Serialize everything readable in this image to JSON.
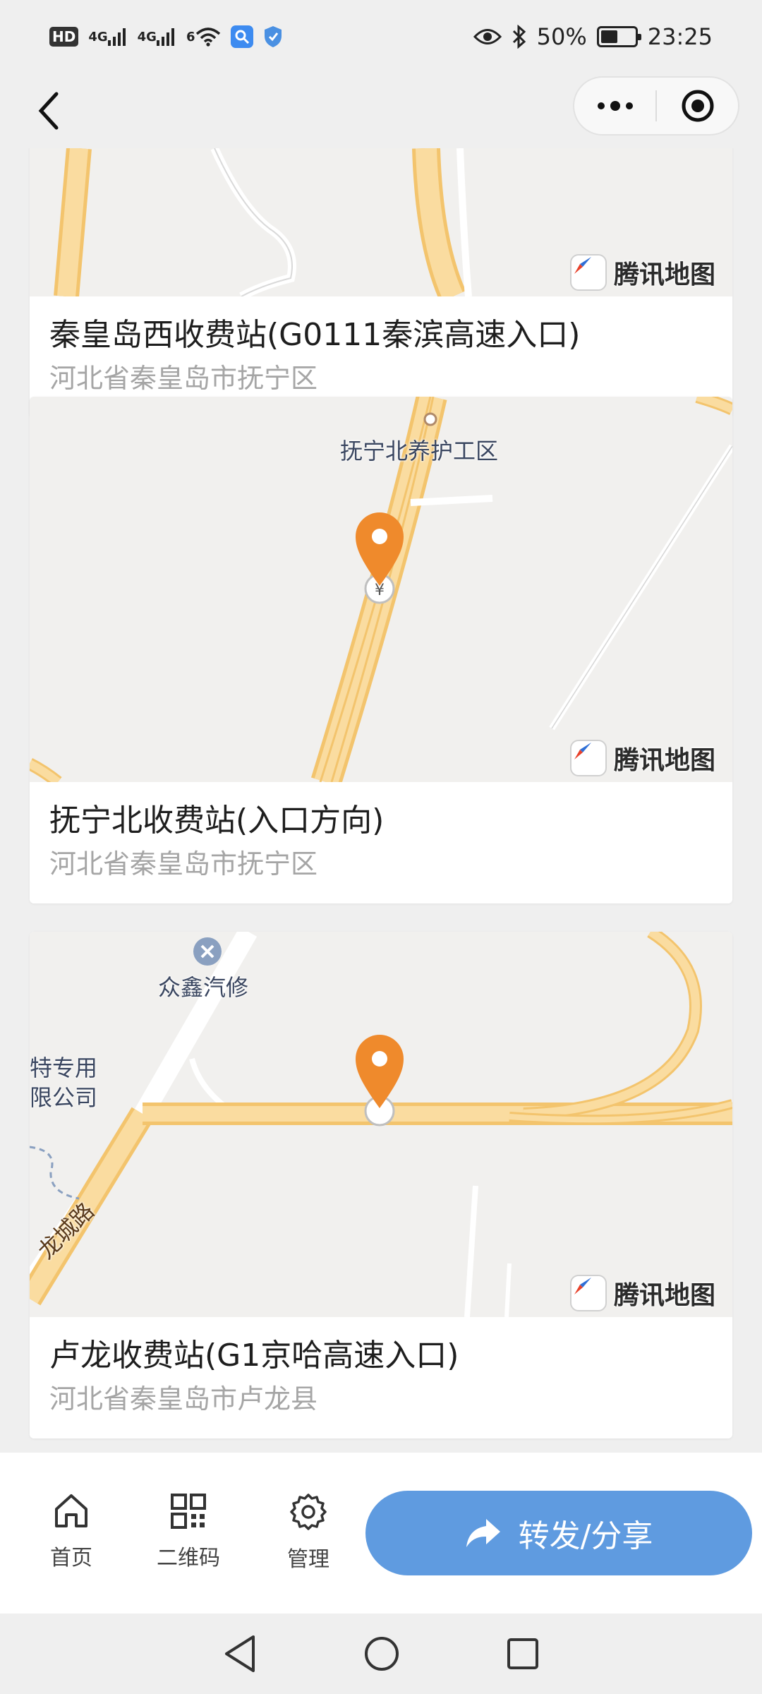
{
  "status_bar": {
    "hd": "HD",
    "net1": "4G",
    "net2": "4G",
    "wifi_tag": "6",
    "battery_percent": "50%",
    "battery_level": 0.5,
    "time": "23:25"
  },
  "nav": {
    "back_icon": "chevron-left-icon",
    "more_icon": "more-dots-icon",
    "close_icon": "target-circle-icon"
  },
  "cards": [
    {
      "title": "秦皇岛西收费站(G0111秦滨高速入口)",
      "address": "河北省秦皇岛市抚宁区",
      "map_logo": "腾讯地图"
    },
    {
      "title": "抚宁北收费站(入口方向)",
      "address": "河北省秦皇岛市抚宁区",
      "map_logo": "腾讯地图",
      "map_labels": [
        "抚宁北养护工区"
      ]
    },
    {
      "title": "卢龙收费站(G1京哈高速入口)",
      "address": "河北省秦皇岛市卢龙县",
      "map_logo": "腾讯地图",
      "map_labels": [
        "众鑫汽修",
        "特专用",
        "限公司",
        "龙城路"
      ]
    }
  ],
  "toolbar": {
    "home_label": "首页",
    "qrcode_label": "二维码",
    "manage_label": "管理",
    "share_label": "转发/分享"
  },
  "colors": {
    "accent": "#5f9be0",
    "marker": "#ef8a2c",
    "road": "#f7d58f"
  }
}
